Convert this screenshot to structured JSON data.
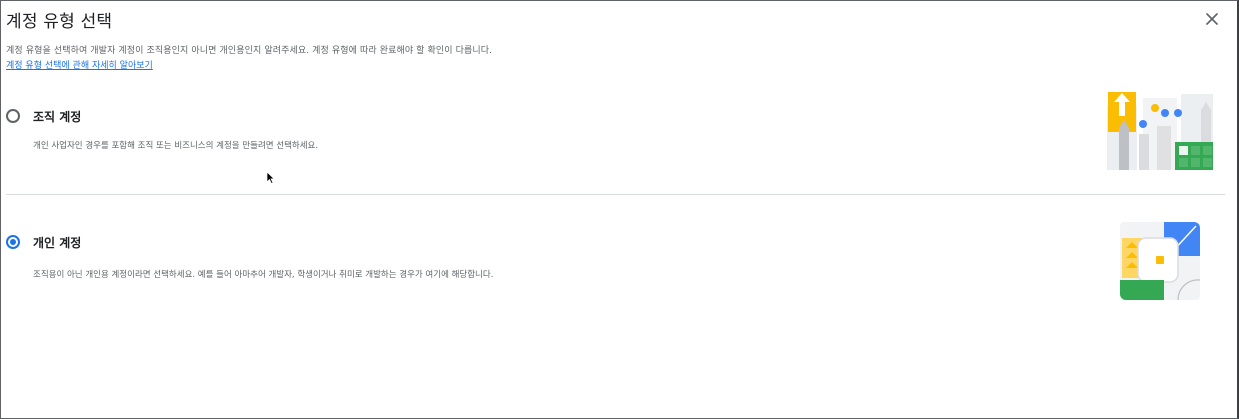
{
  "dialog": {
    "title": "계정 유형 선택",
    "description": "계정 유형을 선택하여 개발자 계정이 조직용인지 아니면 개인용인지 알려주세요. 계정 유형에 따라 완료해야 할 확인이 다릅니다.",
    "learn_more_link": "계정 유형 선택에 관해 자세히 알아보기",
    "close_icon": "close-icon"
  },
  "options": [
    {
      "title": "조직 계정",
      "description": "개인 사업자인 경우를 포함해 조직 또는 비즈니스의 계정을 만들려면 선택하세요.",
      "selected": false,
      "illustration": "organization-illustration"
    },
    {
      "title": "개인 계정",
      "description": "조직용이 아닌 개인용 계정이라면 선택하세요. 예를 들어 아마추어 개발자, 학생이거나 취미로 개발하는 경우가 여기에 해당합니다.",
      "selected": true,
      "illustration": "personal-illustration"
    }
  ],
  "colors": {
    "accent": "#1a73e8",
    "title_text": "#202124",
    "secondary_text": "#5f6368",
    "divider": "#dadce0",
    "illus_yellow": "#fbbc04",
    "illus_blue": "#4285f4",
    "illus_green": "#34a853",
    "illus_red": "#ea4335",
    "illus_grey": "#dadce0"
  }
}
